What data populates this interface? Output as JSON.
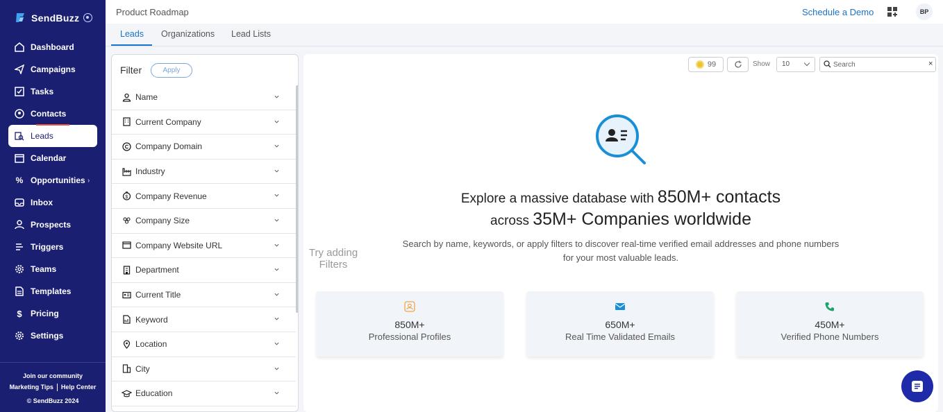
{
  "app": {
    "name": "SendBuzz"
  },
  "sidebar": {
    "items": [
      {
        "label": "Dashboard",
        "icon": "home-icon"
      },
      {
        "label": "Campaigns",
        "icon": "send-icon"
      },
      {
        "label": "Tasks",
        "icon": "checkbox-icon"
      },
      {
        "label": "Contacts",
        "icon": "contact-icon"
      },
      {
        "label": "Leads",
        "icon": "lead-search-icon",
        "active": true
      },
      {
        "label": "Calendar",
        "icon": "calendar-icon"
      },
      {
        "label": "Opportunities",
        "icon": "percent-icon"
      },
      {
        "label": "Inbox",
        "icon": "inbox-icon"
      },
      {
        "label": "Prospects",
        "icon": "user-icon"
      },
      {
        "label": "Triggers",
        "icon": "trigger-icon"
      },
      {
        "label": "Teams",
        "icon": "gear-icon"
      },
      {
        "label": "Templates",
        "icon": "document-icon"
      },
      {
        "label": "Pricing",
        "icon": "dollar-icon"
      },
      {
        "label": "Settings",
        "icon": "settings-icon"
      }
    ],
    "footer": {
      "community": "Join our community",
      "marketing_tips": "Marketing Tips",
      "help_center": "Help Center",
      "copyright": "© SendBuzz 2024"
    }
  },
  "header": {
    "title": "Product Roadmap",
    "demo_link": "Schedule a Demo",
    "avatar_initials": "BP"
  },
  "tabs": [
    {
      "label": "Leads",
      "active": true
    },
    {
      "label": "Organizations"
    },
    {
      "label": "Lead Lists"
    }
  ],
  "filter": {
    "title": "Filter",
    "apply_label": "Apply",
    "items": [
      {
        "label": "Name",
        "icon": "person-icon"
      },
      {
        "label": "Current Company",
        "icon": "building-icon"
      },
      {
        "label": "Company Domain",
        "icon": "copyright-icon"
      },
      {
        "label": "Industry",
        "icon": "industry-icon"
      },
      {
        "label": "Company Revenue",
        "icon": "revenue-icon"
      },
      {
        "label": "Company Size",
        "icon": "group-icon"
      },
      {
        "label": "Company Website URL",
        "icon": "browser-icon"
      },
      {
        "label": "Department",
        "icon": "department-icon"
      },
      {
        "label": "Current Title",
        "icon": "id-card-icon"
      },
      {
        "label": "Keyword",
        "icon": "keyword-icon"
      },
      {
        "label": "Location",
        "icon": "location-pin-icon"
      },
      {
        "label": "City",
        "icon": "city-icon"
      },
      {
        "label": "Education",
        "icon": "graduation-cap-icon"
      }
    ]
  },
  "toolbar": {
    "credits": "99",
    "show_label": "Show",
    "page_size": "10",
    "search_placeholder": "Search",
    "clear_label": "×"
  },
  "hero": {
    "line1_small": "Explore a massive database with ",
    "line1_big": "850M+ contacts",
    "line2_small": "across ",
    "line2_big": "35M+ Companies worldwide",
    "subtitle": "Search by name, keywords, or apply filters to discover real-time verified email addresses and phone numbers for your most valuable leads.",
    "try_adding": "Try adding Filters"
  },
  "stats": [
    {
      "value": "850M+",
      "label": "Professional Profiles",
      "icon": "profile-badge-icon",
      "color": "#f0a44a"
    },
    {
      "value": "650M+",
      "label": "Real Time Validated Emails",
      "icon": "envelope-icon",
      "color": "#1a8fd6"
    },
    {
      "value": "450M+",
      "label": "Verified Phone Numbers",
      "icon": "phone-icon",
      "color": "#1aa36b"
    }
  ],
  "colors": {
    "sidebar_bg": "#1a1f71",
    "accent": "#1a73c8",
    "chat_fab": "#1f2aa8"
  }
}
